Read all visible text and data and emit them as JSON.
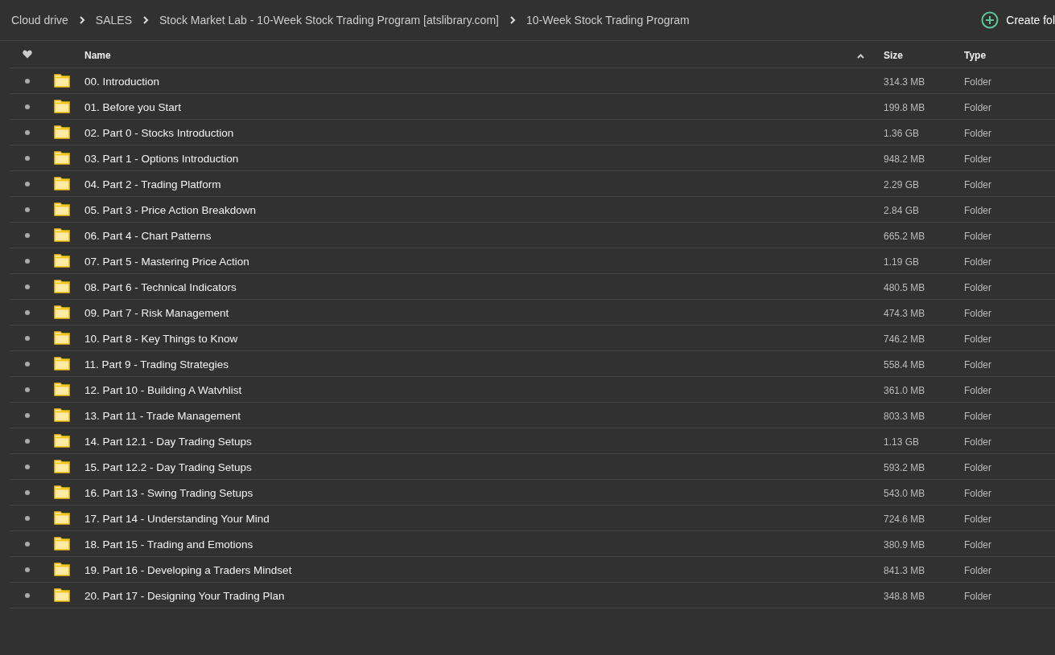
{
  "breadcrumb": [
    "Cloud drive",
    "SALES",
    "Stock Market Lab - 10-Week Stock Trading Program [atslibrary.com]",
    "10-Week Stock Trading Program"
  ],
  "create_button": "Create fol",
  "columns": {
    "name": "Name",
    "size": "Size",
    "type": "Type"
  },
  "rows": [
    {
      "name": "00. Introduction",
      "size": "314.3 MB",
      "type": "Folder"
    },
    {
      "name": "01. Before you Start",
      "size": "199.8 MB",
      "type": "Folder"
    },
    {
      "name": "02. Part 0 - Stocks Introduction",
      "size": "1.36 GB",
      "type": "Folder"
    },
    {
      "name": "03. Part 1 - Options Introduction",
      "size": "948.2 MB",
      "type": "Folder"
    },
    {
      "name": "04. Part 2 - Trading Platform",
      "size": "2.29 GB",
      "type": "Folder"
    },
    {
      "name": "05. Part 3 - Price Action Breakdown",
      "size": "2.84 GB",
      "type": "Folder"
    },
    {
      "name": "06. Part 4 - Chart Patterns",
      "size": "665.2 MB",
      "type": "Folder"
    },
    {
      "name": "07. Part 5 - Mastering Price Action",
      "size": "1.19 GB",
      "type": "Folder"
    },
    {
      "name": "08. Part 6 - Technical Indicators",
      "size": "480.5 MB",
      "type": "Folder"
    },
    {
      "name": "09. Part 7 - Risk Management",
      "size": "474.3 MB",
      "type": "Folder"
    },
    {
      "name": "10. Part 8 - Key Things to Know",
      "size": "746.2 MB",
      "type": "Folder"
    },
    {
      "name": "11. Part 9 - Trading Strategies",
      "size": "558.4 MB",
      "type": "Folder"
    },
    {
      "name": "12. Part 10 - Building A Watvhlist",
      "size": "361.0 MB",
      "type": "Folder"
    },
    {
      "name": "13. Part 11 - Trade Management",
      "size": "803.3 MB",
      "type": "Folder"
    },
    {
      "name": "14. Part 12.1 - Day Trading Setups",
      "size": "1.13 GB",
      "type": "Folder"
    },
    {
      "name": "15. Part 12.2 - Day Trading Setups",
      "size": "593.2 MB",
      "type": "Folder"
    },
    {
      "name": "16. Part 13 - Swing Trading Setups",
      "size": "543.0 MB",
      "type": "Folder"
    },
    {
      "name": "17. Part 14 - Understanding Your Mind",
      "size": "724.6 MB",
      "type": "Folder"
    },
    {
      "name": "18. Part 15 - Trading and Emotions",
      "size": "380.9 MB",
      "type": "Folder"
    },
    {
      "name": "19. Part 16 - Developing a Traders Mindset",
      "size": "841.3 MB",
      "type": "Folder"
    },
    {
      "name": "20. Part 17 - Designing Your Trading Plan",
      "size": "348.8 MB",
      "type": "Folder"
    }
  ]
}
